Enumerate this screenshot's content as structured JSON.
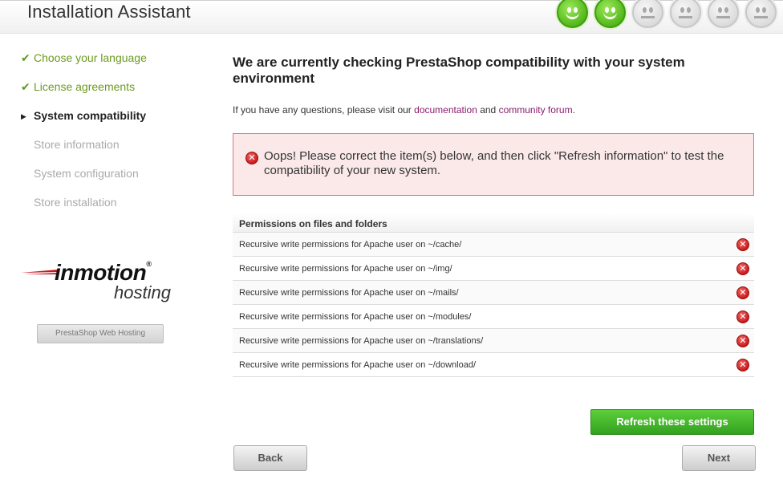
{
  "header": {
    "title": "Installation Assistant",
    "progress": {
      "completed": 2,
      "total": 6
    }
  },
  "steps": [
    {
      "label": "Choose your language",
      "status": "done"
    },
    {
      "label": "License agreements",
      "status": "done"
    },
    {
      "label": "System compatibility",
      "status": "current"
    },
    {
      "label": "Store information",
      "status": "todo"
    },
    {
      "label": "System configuration",
      "status": "todo"
    },
    {
      "label": "Store installation",
      "status": "todo"
    }
  ],
  "logo": {
    "brand": "inmotion",
    "sub": "hosting",
    "reg": "®"
  },
  "hosting_button": "PrestaShop Web Hosting",
  "main": {
    "title": "We are currently checking PrestaShop compatibility with your system environment",
    "questions_prefix": "If you have any questions, please visit our ",
    "documentation_link": "documentation",
    "and_text": " and ",
    "forum_link": "community forum",
    "questions_suffix": "."
  },
  "alert": {
    "message": "Oops! Please correct the item(s) below, and then click \"Refresh information\" to test the compatibility of your new system."
  },
  "permissions": {
    "heading": "Permissions on files and folders",
    "rows": [
      "Recursive write permissions for Apache user on ~/cache/",
      "Recursive write permissions for Apache user on ~/img/",
      "Recursive write permissions for Apache user on ~/mails/",
      "Recursive write permissions for Apache user on ~/modules/",
      "Recursive write permissions for Apache user on ~/translations/",
      "Recursive write permissions for Apache user on ~/download/"
    ],
    "status_icon": "error-icon"
  },
  "buttons": {
    "refresh": "Refresh these settings",
    "back": "Back",
    "next": "Next"
  },
  "colors": {
    "done": "#6c9a1f",
    "link": "#8a1c6c",
    "alert_bg": "#fbe9e9",
    "refresh": "#34a120"
  }
}
